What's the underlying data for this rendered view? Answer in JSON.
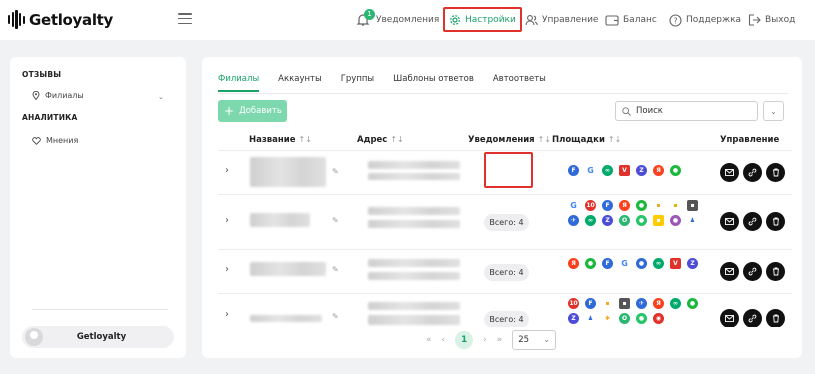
{
  "app": {
    "logo_text": "Getloyalty"
  },
  "nav": {
    "notifications": "Уведомления",
    "notifications_badge": "1",
    "settings": "Настройки",
    "management": "Управление",
    "balance": "Баланс",
    "support": "Поддержка",
    "logout": "Выход"
  },
  "sidebar": {
    "section_reviews": "ОТЗЫВЫ",
    "item_branches": "Филиалы",
    "section_analytics": "АНАЛИТИКА",
    "item_opinions": "Мнения",
    "user_name": "Getloyalty"
  },
  "tabs": [
    "Филиалы",
    "Аккаунты",
    "Группы",
    "Шаблоны ответов",
    "Автоответы"
  ],
  "toolbar": {
    "add_label": "Добавить",
    "search_placeholder": "Поиск"
  },
  "table": {
    "headers": {
      "name": "Название",
      "address": "Адрес",
      "notifications": "Уведомления",
      "platforms": "Площадки",
      "actions": "Управление"
    },
    "rows": [
      {
        "notifications": ""
      },
      {
        "notifications": "Всего: 4"
      },
      {
        "notifications": "Всего: 4"
      },
      {
        "notifications": "Всего: 4"
      }
    ]
  },
  "pagination": {
    "current_page": "1",
    "page_size": "25"
  },
  "colors": {
    "accent": "#1ba36a",
    "highlight": "#e0312b"
  }
}
